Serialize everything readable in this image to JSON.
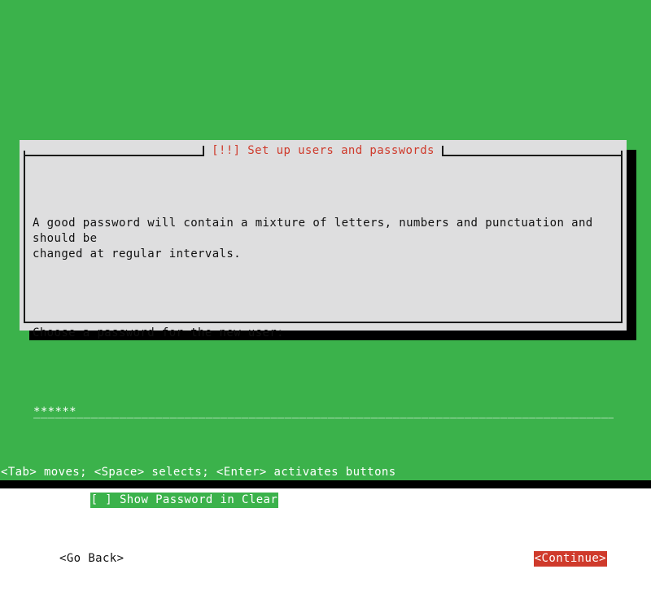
{
  "screen": {
    "background_color": "#3bb24b",
    "foreground_color": "#ffffff"
  },
  "dialog": {
    "title": "[!!] Set up users and passwords",
    "title_color": "#cf3a2b",
    "background_color": "#dededf",
    "border_color": "#1a1a1a",
    "shadow_color": "#000000",
    "paragraphs": {
      "intro": "A good password will contain a mixture of letters, numbers and punctuation and should be\nchanged at regular intervals.",
      "prompt": "Choose a password for the new user:"
    },
    "password_field": {
      "name": "password-input",
      "masked_value": "******",
      "masked_char_count": 6,
      "fill_text": "______________________________________________________________________________________",
      "background_color": "#3bb24b",
      "text_color": "#ffffff",
      "focused": true
    },
    "checkbox": {
      "label": "[ ] Show Password in Clear",
      "checked": false,
      "highlighted": true,
      "highlight_color": "#3bb24b",
      "text_color": "#ffffff"
    },
    "buttons": {
      "go_back": {
        "label": "<Go Back>",
        "selected": false,
        "text_color": "#111111"
      },
      "continue": {
        "label": "<Continue>",
        "selected": true,
        "background_color": "#cf3a2b",
        "text_color": "#ffffff"
      }
    }
  },
  "help_bar": {
    "text": "<Tab> moves; <Space> selects; <Enter> activates buttons",
    "background_color": "#3bb24b",
    "text_color": "#ffffff"
  }
}
